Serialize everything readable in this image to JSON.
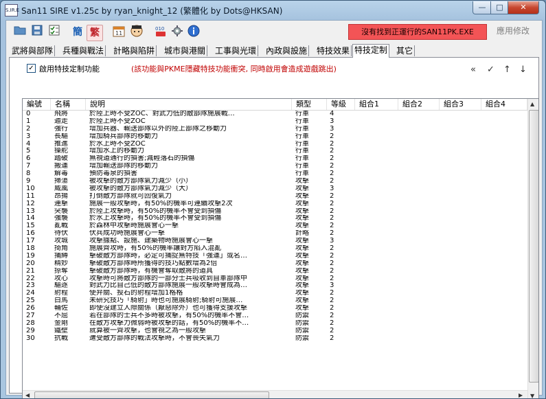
{
  "window": {
    "title": "San11 SIRE v1.25c by ryan_knight_12 (繁體化 by Dots@HKSAN)",
    "app_icon_text": "S.IR.E",
    "min": "—",
    "max": "□",
    "close": "✕"
  },
  "toolbar": {
    "trad_label": "簡",
    "simp_label": "繁",
    "status_text": "沒有找到正運行的SAN11PK.EXE",
    "apply_label": "應用修改"
  },
  "tabs": [
    "武將與部隊",
    "兵種與戰法",
    "計略與陷阱",
    "城市與港關",
    "工事與光環",
    "內政與設施",
    "特技效果",
    "特技定制",
    "其它"
  ],
  "selected_tab": "特技定制",
  "option": {
    "checked": true,
    "label": "啟用特技定制功能",
    "note": "(該功能與PKME隱藏特技功能衝突, 同時啟用會造成遊戲跳出)"
  },
  "grid": {
    "columns": [
      "編號",
      "名稱",
      "說明",
      "類型",
      "等級",
      "組合1",
      "組合2",
      "組合3",
      "組合4"
    ],
    "rows": [
      [
        "0",
        "飛將",
        "於陸上時不受ZOC、對武力低的敵部隊施展戰…",
        "行軍",
        "4"
      ],
      [
        "1",
        "遁走",
        "於陸上時不受ZOC",
        "行軍",
        "3"
      ],
      [
        "2",
        "強行",
        "增加兵器、輸送部隊以外的陸上部隊之移動力",
        "行軍",
        "3"
      ],
      [
        "3",
        "長驅",
        "增加騎兵部隊的移動力",
        "行軍",
        "2"
      ],
      [
        "4",
        "推進",
        "於水上時不受ZOC",
        "行軍",
        "2"
      ],
      [
        "5",
        "操舵",
        "增加水上的移動力",
        "行軍",
        "2"
      ],
      [
        "6",
        "踏破",
        "無視道通行的損害;減輕落石的損傷",
        "行軍",
        "2"
      ],
      [
        "7",
        "搬運",
        "增加輸送部隊的移動力",
        "行軍",
        "2"
      ],
      [
        "8",
        "解毒",
        "預防毒泉的損害",
        "行軍",
        "2"
      ],
      [
        "9",
        "掃蕩",
        "被攻擊的敵方部隊氣力減少（小）",
        "攻擊",
        "2"
      ],
      [
        "10",
        "威風",
        "被攻擊的敵方部隊氣力減少（大）",
        "攻擊",
        "3"
      ],
      [
        "11",
        "昂揚",
        "打倒敵方部隊就可回復氣力",
        "攻擊",
        "2"
      ],
      [
        "12",
        "連擊",
        "施展一般攻擊時，有50%的機率可連續攻擊2次",
        "攻擊",
        "2"
      ],
      [
        "13",
        "突襲",
        "於陸上攻擊時，有50%的機率不會受到損傷",
        "攻擊",
        "2"
      ],
      [
        "14",
        "強襲",
        "於水上攻擊時，有50%的機率不會受到損傷",
        "攻擊",
        "2"
      ],
      [
        "15",
        "亂戰",
        "於森林中攻擊時施展會心一擊",
        "攻擊",
        "2"
      ],
      [
        "16",
        "待伏",
        "伏兵成功時施展會心一擊",
        "計略",
        "2"
      ],
      [
        "17",
        "攻城",
        "攻擊據點、設施、建築物時施展會心一擊",
        "攻擊",
        "3"
      ],
      [
        "18",
        "掎角",
        "施展齊攻時，有50%的機率讓對方陷入混亂",
        "攻擊",
        "2"
      ],
      [
        "19",
        "捕縛",
        "擊破敵方部隊時，必定可捕捉無特技「強運」或名…",
        "攻擊",
        "2"
      ],
      [
        "20",
        "精妙",
        "擊破敵方部隊時所獲得的技巧點數增為2倍",
        "攻擊",
        "2"
      ],
      [
        "21",
        "掠奪",
        "擊破敵方部隊時，有機會奪取敵將的道具",
        "攻擊",
        "2"
      ],
      [
        "22",
        "攻心",
        "攻擊時可將敵方部隊的一部分士兵吸收到自軍部隊中",
        "攻擊",
        "2"
      ],
      [
        "23",
        "驅逐",
        "對武力比自己低的敵方部隊施展一般攻擊時會成為…",
        "攻擊",
        "3"
      ],
      [
        "24",
        "射程",
        "使弁關、投石的射程增加1格格",
        "攻擊",
        "2"
      ],
      [
        "25",
        "白馬",
        "未研究技巧「騎射」時也可施展騎射;騎射可施展…",
        "攻擊",
        "2"
      ],
      [
        "26",
        "輔佐",
        "即使沒建立人際關係（厭惡除外）也可獲得支援攻擊",
        "攻擊",
        "2"
      ],
      [
        "27",
        "不屈",
        "若在部隊的士兵不多時被攻擊，有50%的機率不會…",
        "防禦",
        "2"
      ],
      [
        "28",
        "金剛",
        "在敵方攻擊力微弱時被攻擊的話，有50%的機率不…",
        "防禦",
        "2"
      ],
      [
        "29",
        "鐵壁",
        "就算被一齊攻擊，也會視之為一般攻擊",
        "防禦",
        "2"
      ],
      [
        "30",
        "抗戰",
        "遭受敵方部隊的戰法攻擊時，不會喪失氣力",
        "防禦",
        "2"
      ]
    ]
  }
}
